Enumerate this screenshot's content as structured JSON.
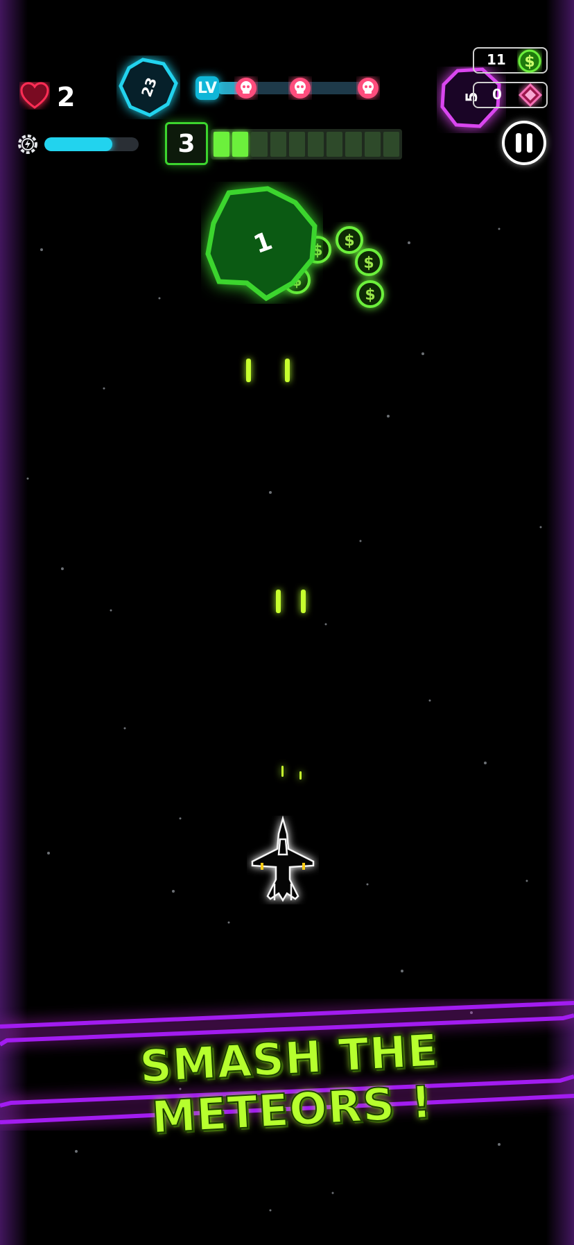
{
  "hud": {
    "lives": "2",
    "energy_fraction": 0.72,
    "level_badge": "LV",
    "level_progress_fraction": 0.18,
    "stage_number": "3",
    "stage_segments_total": 10,
    "stage_segments_filled": 2,
    "cash": "11",
    "gems": "0",
    "boss_meteor_hp": "23",
    "currency_icons": [
      "dollar-coin-icon",
      "pink-gem-icon"
    ]
  },
  "field": {
    "main_meteor_hp": "1",
    "purple_meteor_hp": "5"
  },
  "banner": {
    "text": "SMASH THE METEORS !"
  },
  "colors": {
    "neon_green": "#3cd52e",
    "neon_lime": "#b6ff2e",
    "neon_cyan": "#22d3ee",
    "neon_purple": "#a21cf0",
    "neon_magenta": "#d946ef",
    "heart_red": "#e11d48"
  }
}
